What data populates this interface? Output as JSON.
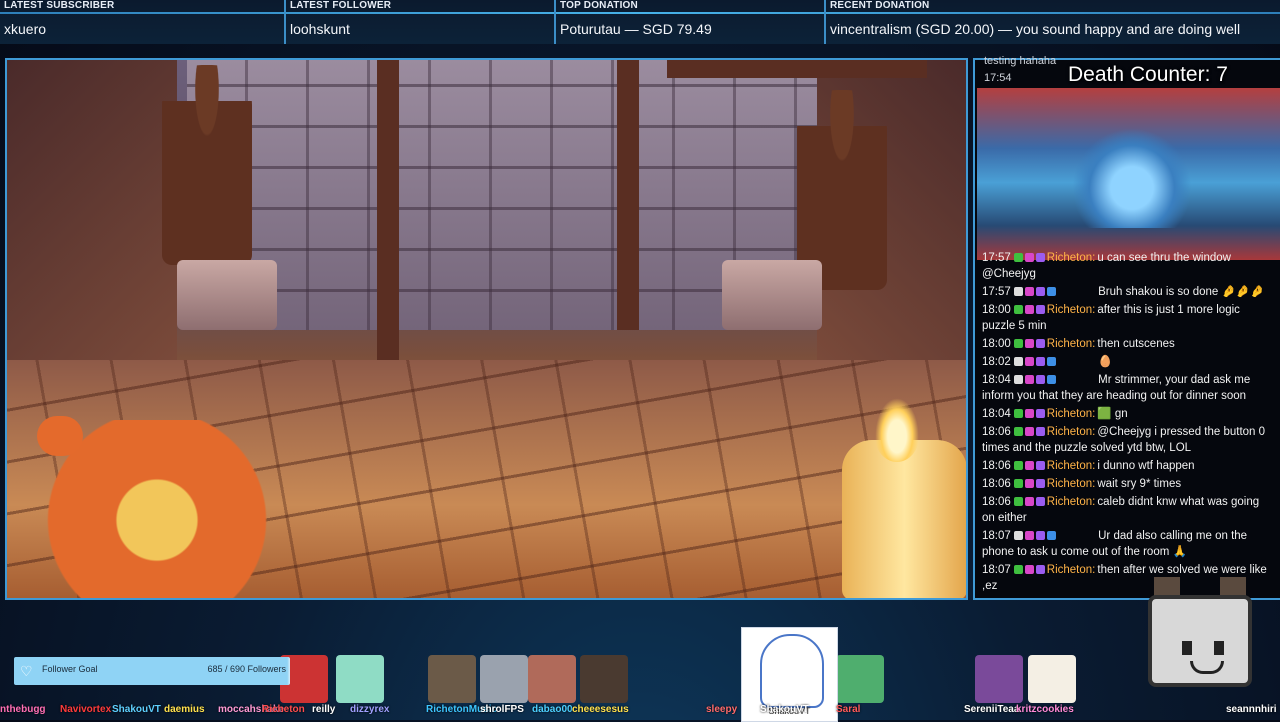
{
  "ticker": {
    "latest_subscriber": {
      "label": "LATEST SUBSCRIBER",
      "value": "xkuero"
    },
    "latest_follower": {
      "label": "LATEST FOLLOWER",
      "value": "loohskunt"
    },
    "top_donation": {
      "label": "TOP DONATION",
      "value": "Poturutau — SGD 79.49"
    },
    "recent_donation": {
      "label": "RECENT DONATION",
      "value": "vincentralism (SGD 20.00) — you sound happy and are doing well"
    }
  },
  "overlay": {
    "death_counter": "Death Counter: 7",
    "chat_partial_top": "testing hahaha",
    "chat_partial_time": "17:54"
  },
  "chat": [
    {
      "time": "17:57",
      "badges": [
        "green",
        "pink",
        "purple"
      ],
      "user": "Richeton:",
      "user_class": "rich",
      "text": "u can see thru the window @Cheejyg"
    },
    {
      "time": "17:57",
      "badges": [
        "white",
        "pink",
        "purple",
        "blue"
      ],
      "user": "",
      "user_class": "hidden",
      "text": "Bruh shakou is so done 🤌🤌🤌"
    },
    {
      "time": "18:00",
      "badges": [
        "green",
        "pink",
        "purple"
      ],
      "user": "Richeton:",
      "user_class": "rich",
      "text": "after this is just 1 more logic puzzle 5 min"
    },
    {
      "time": "18:00",
      "badges": [
        "green",
        "pink",
        "purple"
      ],
      "user": "Richeton:",
      "user_class": "rich",
      "text": "then cutscenes"
    },
    {
      "time": "18:02",
      "badges": [
        "white",
        "pink",
        "purple",
        "blue"
      ],
      "user": "",
      "user_class": "hidden",
      "text": "🥚"
    },
    {
      "time": "18:04",
      "badges": [
        "white",
        "pink",
        "purple",
        "blue"
      ],
      "user": "",
      "user_class": "hidden",
      "text": "Mr strimmer, your dad ask me inform you that they are heading out for dinner soon"
    },
    {
      "time": "18:04",
      "badges": [
        "green",
        "pink",
        "purple"
      ],
      "user": "Richeton:",
      "user_class": "rich",
      "text": "🟩 gn"
    },
    {
      "time": "18:06",
      "badges": [
        "green",
        "pink",
        "purple"
      ],
      "user": "Richeton:",
      "user_class": "rich",
      "text": "@Cheejyg i pressed the button 0 times and the puzzle solved ytd btw, LOL"
    },
    {
      "time": "18:06",
      "badges": [
        "green",
        "pink",
        "purple"
      ],
      "user": "Richeton:",
      "user_class": "rich",
      "text": "i dunno wtf happen"
    },
    {
      "time": "18:06",
      "badges": [
        "green",
        "pink",
        "purple"
      ],
      "user": "Richeton:",
      "user_class": "rich",
      "text": "wait sry 9* times"
    },
    {
      "time": "18:06",
      "badges": [
        "green",
        "pink",
        "purple"
      ],
      "user": "Richeton:",
      "user_class": "rich",
      "text": "caleb didnt knw what was going on either"
    },
    {
      "time": "18:07",
      "badges": [
        "white",
        "pink",
        "purple",
        "blue"
      ],
      "user": "",
      "user_class": "hidden",
      "text": "Ur dad also calling me on the phone to ask u come out of the room 🙏"
    },
    {
      "time": "18:07",
      "badges": [
        "green",
        "pink",
        "purple"
      ],
      "user": "Richeton:",
      "user_class": "rich",
      "text": "then after we solved we were like ,ez"
    }
  ],
  "follower_goal": {
    "label": "Follower Goal",
    "count": "685 / 690 Followers",
    "progress": 0.9928
  },
  "bottom_names": [
    "nthebugg",
    "Navivortex",
    "ShakouVT",
    "daemius",
    "moccahshake",
    "Richeton",
    "reilly",
    "dizzyrex",
    "RichetonMusic",
    "shrolFPS",
    "dabao00",
    "cheeesesus",
    "sleepy",
    "ShakouVT",
    "Saral",
    "SereniiTeaa",
    "kritzcookies",
    "seannnhiri"
  ],
  "center_card_name": "ShakouVT",
  "colors": {
    "accent": "#3f9ad6",
    "goal_bar": "#8fd3f5",
    "richeton": "#ffb347"
  }
}
